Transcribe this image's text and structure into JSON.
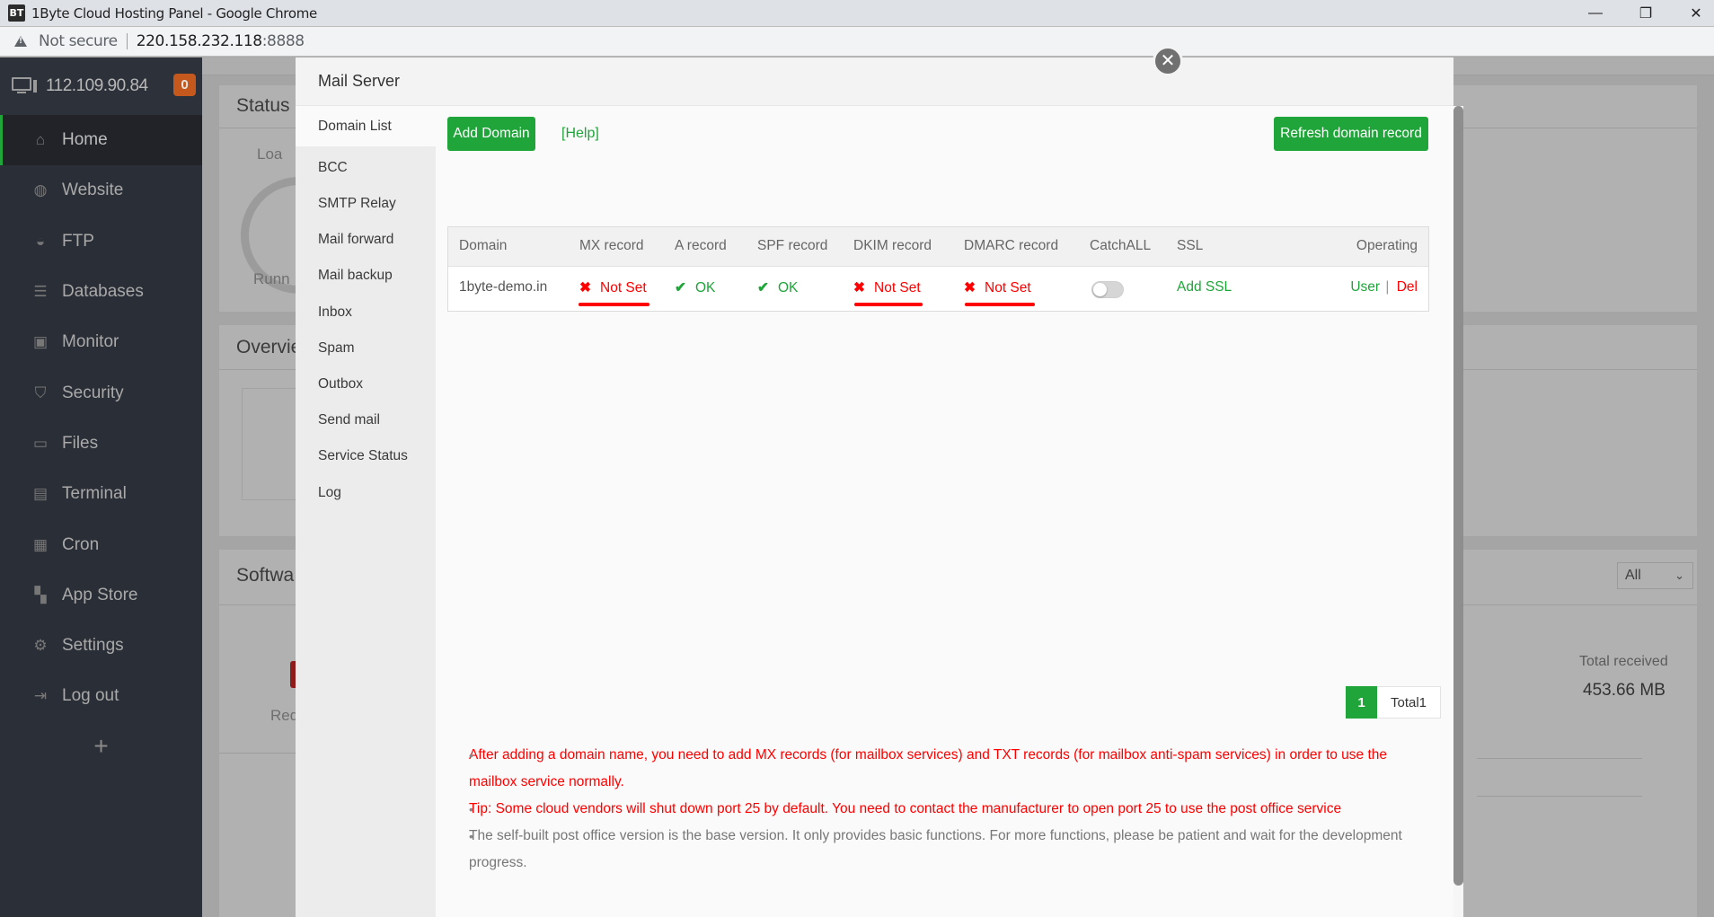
{
  "browser": {
    "window_title": "1Byte Cloud Hosting Panel - Google Chrome",
    "logo_text": "BT",
    "security_label": "Not secure",
    "url_host": "220.158.232.118",
    "url_port": ":8888",
    "controls": {
      "minimize": "—",
      "restore": "❐",
      "close": "✕"
    }
  },
  "sidebar": {
    "server_ip": "112.109.90.84",
    "notification_count": "0",
    "items": [
      {
        "label": "Home",
        "icon": "home-icon",
        "glyph": "⌂",
        "active": true
      },
      {
        "label": "Website",
        "icon": "globe-icon",
        "glyph": "◍"
      },
      {
        "label": "FTP",
        "icon": "ftp-icon",
        "glyph": "◒"
      },
      {
        "label": "Databases",
        "icon": "database-icon",
        "glyph": "☰"
      },
      {
        "label": "Monitor",
        "icon": "monitor-icon",
        "glyph": "▣"
      },
      {
        "label": "Security",
        "icon": "shield-icon",
        "glyph": "⛉"
      },
      {
        "label": "Files",
        "icon": "folder-icon",
        "glyph": "▭"
      },
      {
        "label": "Terminal",
        "icon": "terminal-icon",
        "glyph": "▤"
      },
      {
        "label": "Cron",
        "icon": "calendar-icon",
        "glyph": "▦"
      },
      {
        "label": "App Store",
        "icon": "apps-icon",
        "glyph": "▚"
      },
      {
        "label": "Settings",
        "icon": "gear-icon",
        "glyph": "⚙"
      },
      {
        "label": "Log out",
        "icon": "logout-icon",
        "glyph": "⇥"
      }
    ],
    "add_label": "+"
  },
  "background": {
    "status_title": "Status",
    "load_label": "Loa",
    "running_label": "Runn",
    "overview_title": "Overvie",
    "software_title": "Softwa",
    "redis_label": "Redi",
    "filter_select": "All",
    "total_received_label": "Total received",
    "total_received_value": "453.66 MB"
  },
  "modal": {
    "title": "Mail Server",
    "close_glyph": "✕",
    "menu": [
      {
        "label": "Domain List",
        "active": true
      },
      {
        "label": "BCC"
      },
      {
        "label": "SMTP Relay"
      },
      {
        "label": "Mail forward"
      },
      {
        "label": "Mail backup"
      },
      {
        "label": "Inbox"
      },
      {
        "label": "Spam"
      },
      {
        "label": "Outbox"
      },
      {
        "label": "Send mail"
      },
      {
        "label": "Service Status"
      },
      {
        "label": "Log"
      }
    ],
    "toolbar": {
      "add_domain": "Add Domain",
      "help": "[Help]",
      "refresh": "Refresh domain record"
    },
    "table": {
      "columns": [
        "Domain",
        "MX record",
        "A record",
        "SPF record",
        "DKIM record",
        "DMARC record",
        "CatchALL",
        "SSL",
        "Operating"
      ],
      "rows": [
        {
          "domain": "1byte-demo.in",
          "mx": {
            "mark": "✖",
            "text": "Not Set",
            "status": "bad"
          },
          "a": {
            "mark": "✔",
            "text": "OK",
            "status": "ok"
          },
          "spf": {
            "mark": "✔",
            "text": "OK",
            "status": "ok"
          },
          "dkim": {
            "mark": "✖",
            "text": "Not Set",
            "status": "bad"
          },
          "dmarc": {
            "mark": "✖",
            "text": "Not Set",
            "status": "bad"
          },
          "catchall": false,
          "ssl": "Add SSL",
          "op_user": "User",
          "op_sep": "|",
          "op_del": "Del"
        }
      ]
    },
    "pagination": {
      "current": "1",
      "total": "Total1"
    },
    "notes": [
      {
        "text": "After adding a domain name, you need to add MX records (for mailbox services) and TXT records (for mailbox anti-spam services) in order to use the mailbox service normally.",
        "color": "red"
      },
      {
        "text": "Tip: Some cloud vendors will shut down port 25 by default. You need to contact the manufacturer to open port 25 to use the post office service",
        "color": "red"
      },
      {
        "text": "The self-built post office version is the base version. It only provides basic functions. For more functions, please be patient and wait for the development progress.",
        "color": "gray"
      }
    ]
  },
  "colors": {
    "brand_green": "#20a53a",
    "error_red": "#ff0000",
    "badge_orange": "#c4581d",
    "sidebar_bg": "#2a2e36"
  }
}
